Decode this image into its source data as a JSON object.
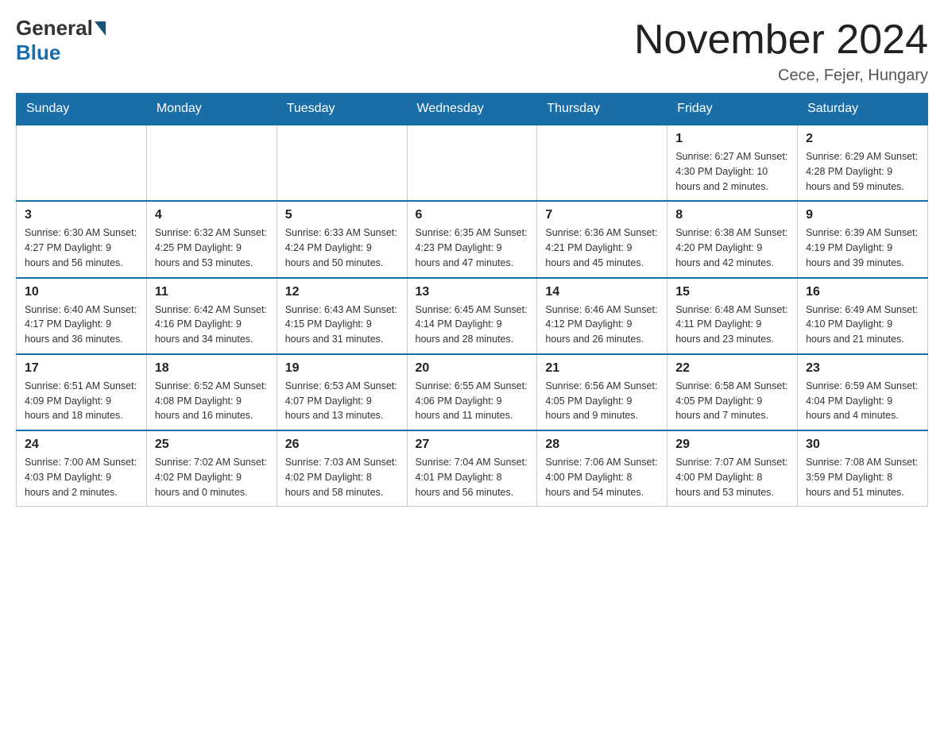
{
  "header": {
    "title": "November 2024",
    "location": "Cece, Fejer, Hungary",
    "logo_general": "General",
    "logo_blue": "Blue"
  },
  "days_of_week": [
    "Sunday",
    "Monday",
    "Tuesday",
    "Wednesday",
    "Thursday",
    "Friday",
    "Saturday"
  ],
  "weeks": [
    [
      {
        "day": "",
        "info": ""
      },
      {
        "day": "",
        "info": ""
      },
      {
        "day": "",
        "info": ""
      },
      {
        "day": "",
        "info": ""
      },
      {
        "day": "",
        "info": ""
      },
      {
        "day": "1",
        "info": "Sunrise: 6:27 AM\nSunset: 4:30 PM\nDaylight: 10 hours and 2 minutes."
      },
      {
        "day": "2",
        "info": "Sunrise: 6:29 AM\nSunset: 4:28 PM\nDaylight: 9 hours and 59 minutes."
      }
    ],
    [
      {
        "day": "3",
        "info": "Sunrise: 6:30 AM\nSunset: 4:27 PM\nDaylight: 9 hours and 56 minutes."
      },
      {
        "day": "4",
        "info": "Sunrise: 6:32 AM\nSunset: 4:25 PM\nDaylight: 9 hours and 53 minutes."
      },
      {
        "day": "5",
        "info": "Sunrise: 6:33 AM\nSunset: 4:24 PM\nDaylight: 9 hours and 50 minutes."
      },
      {
        "day": "6",
        "info": "Sunrise: 6:35 AM\nSunset: 4:23 PM\nDaylight: 9 hours and 47 minutes."
      },
      {
        "day": "7",
        "info": "Sunrise: 6:36 AM\nSunset: 4:21 PM\nDaylight: 9 hours and 45 minutes."
      },
      {
        "day": "8",
        "info": "Sunrise: 6:38 AM\nSunset: 4:20 PM\nDaylight: 9 hours and 42 minutes."
      },
      {
        "day": "9",
        "info": "Sunrise: 6:39 AM\nSunset: 4:19 PM\nDaylight: 9 hours and 39 minutes."
      }
    ],
    [
      {
        "day": "10",
        "info": "Sunrise: 6:40 AM\nSunset: 4:17 PM\nDaylight: 9 hours and 36 minutes."
      },
      {
        "day": "11",
        "info": "Sunrise: 6:42 AM\nSunset: 4:16 PM\nDaylight: 9 hours and 34 minutes."
      },
      {
        "day": "12",
        "info": "Sunrise: 6:43 AM\nSunset: 4:15 PM\nDaylight: 9 hours and 31 minutes."
      },
      {
        "day": "13",
        "info": "Sunrise: 6:45 AM\nSunset: 4:14 PM\nDaylight: 9 hours and 28 minutes."
      },
      {
        "day": "14",
        "info": "Sunrise: 6:46 AM\nSunset: 4:12 PM\nDaylight: 9 hours and 26 minutes."
      },
      {
        "day": "15",
        "info": "Sunrise: 6:48 AM\nSunset: 4:11 PM\nDaylight: 9 hours and 23 minutes."
      },
      {
        "day": "16",
        "info": "Sunrise: 6:49 AM\nSunset: 4:10 PM\nDaylight: 9 hours and 21 minutes."
      }
    ],
    [
      {
        "day": "17",
        "info": "Sunrise: 6:51 AM\nSunset: 4:09 PM\nDaylight: 9 hours and 18 minutes."
      },
      {
        "day": "18",
        "info": "Sunrise: 6:52 AM\nSunset: 4:08 PM\nDaylight: 9 hours and 16 minutes."
      },
      {
        "day": "19",
        "info": "Sunrise: 6:53 AM\nSunset: 4:07 PM\nDaylight: 9 hours and 13 minutes."
      },
      {
        "day": "20",
        "info": "Sunrise: 6:55 AM\nSunset: 4:06 PM\nDaylight: 9 hours and 11 minutes."
      },
      {
        "day": "21",
        "info": "Sunrise: 6:56 AM\nSunset: 4:05 PM\nDaylight: 9 hours and 9 minutes."
      },
      {
        "day": "22",
        "info": "Sunrise: 6:58 AM\nSunset: 4:05 PM\nDaylight: 9 hours and 7 minutes."
      },
      {
        "day": "23",
        "info": "Sunrise: 6:59 AM\nSunset: 4:04 PM\nDaylight: 9 hours and 4 minutes."
      }
    ],
    [
      {
        "day": "24",
        "info": "Sunrise: 7:00 AM\nSunset: 4:03 PM\nDaylight: 9 hours and 2 minutes."
      },
      {
        "day": "25",
        "info": "Sunrise: 7:02 AM\nSunset: 4:02 PM\nDaylight: 9 hours and 0 minutes."
      },
      {
        "day": "26",
        "info": "Sunrise: 7:03 AM\nSunset: 4:02 PM\nDaylight: 8 hours and 58 minutes."
      },
      {
        "day": "27",
        "info": "Sunrise: 7:04 AM\nSunset: 4:01 PM\nDaylight: 8 hours and 56 minutes."
      },
      {
        "day": "28",
        "info": "Sunrise: 7:06 AM\nSunset: 4:00 PM\nDaylight: 8 hours and 54 minutes."
      },
      {
        "day": "29",
        "info": "Sunrise: 7:07 AM\nSunset: 4:00 PM\nDaylight: 8 hours and 53 minutes."
      },
      {
        "day": "30",
        "info": "Sunrise: 7:08 AM\nSunset: 3:59 PM\nDaylight: 8 hours and 51 minutes."
      }
    ]
  ]
}
